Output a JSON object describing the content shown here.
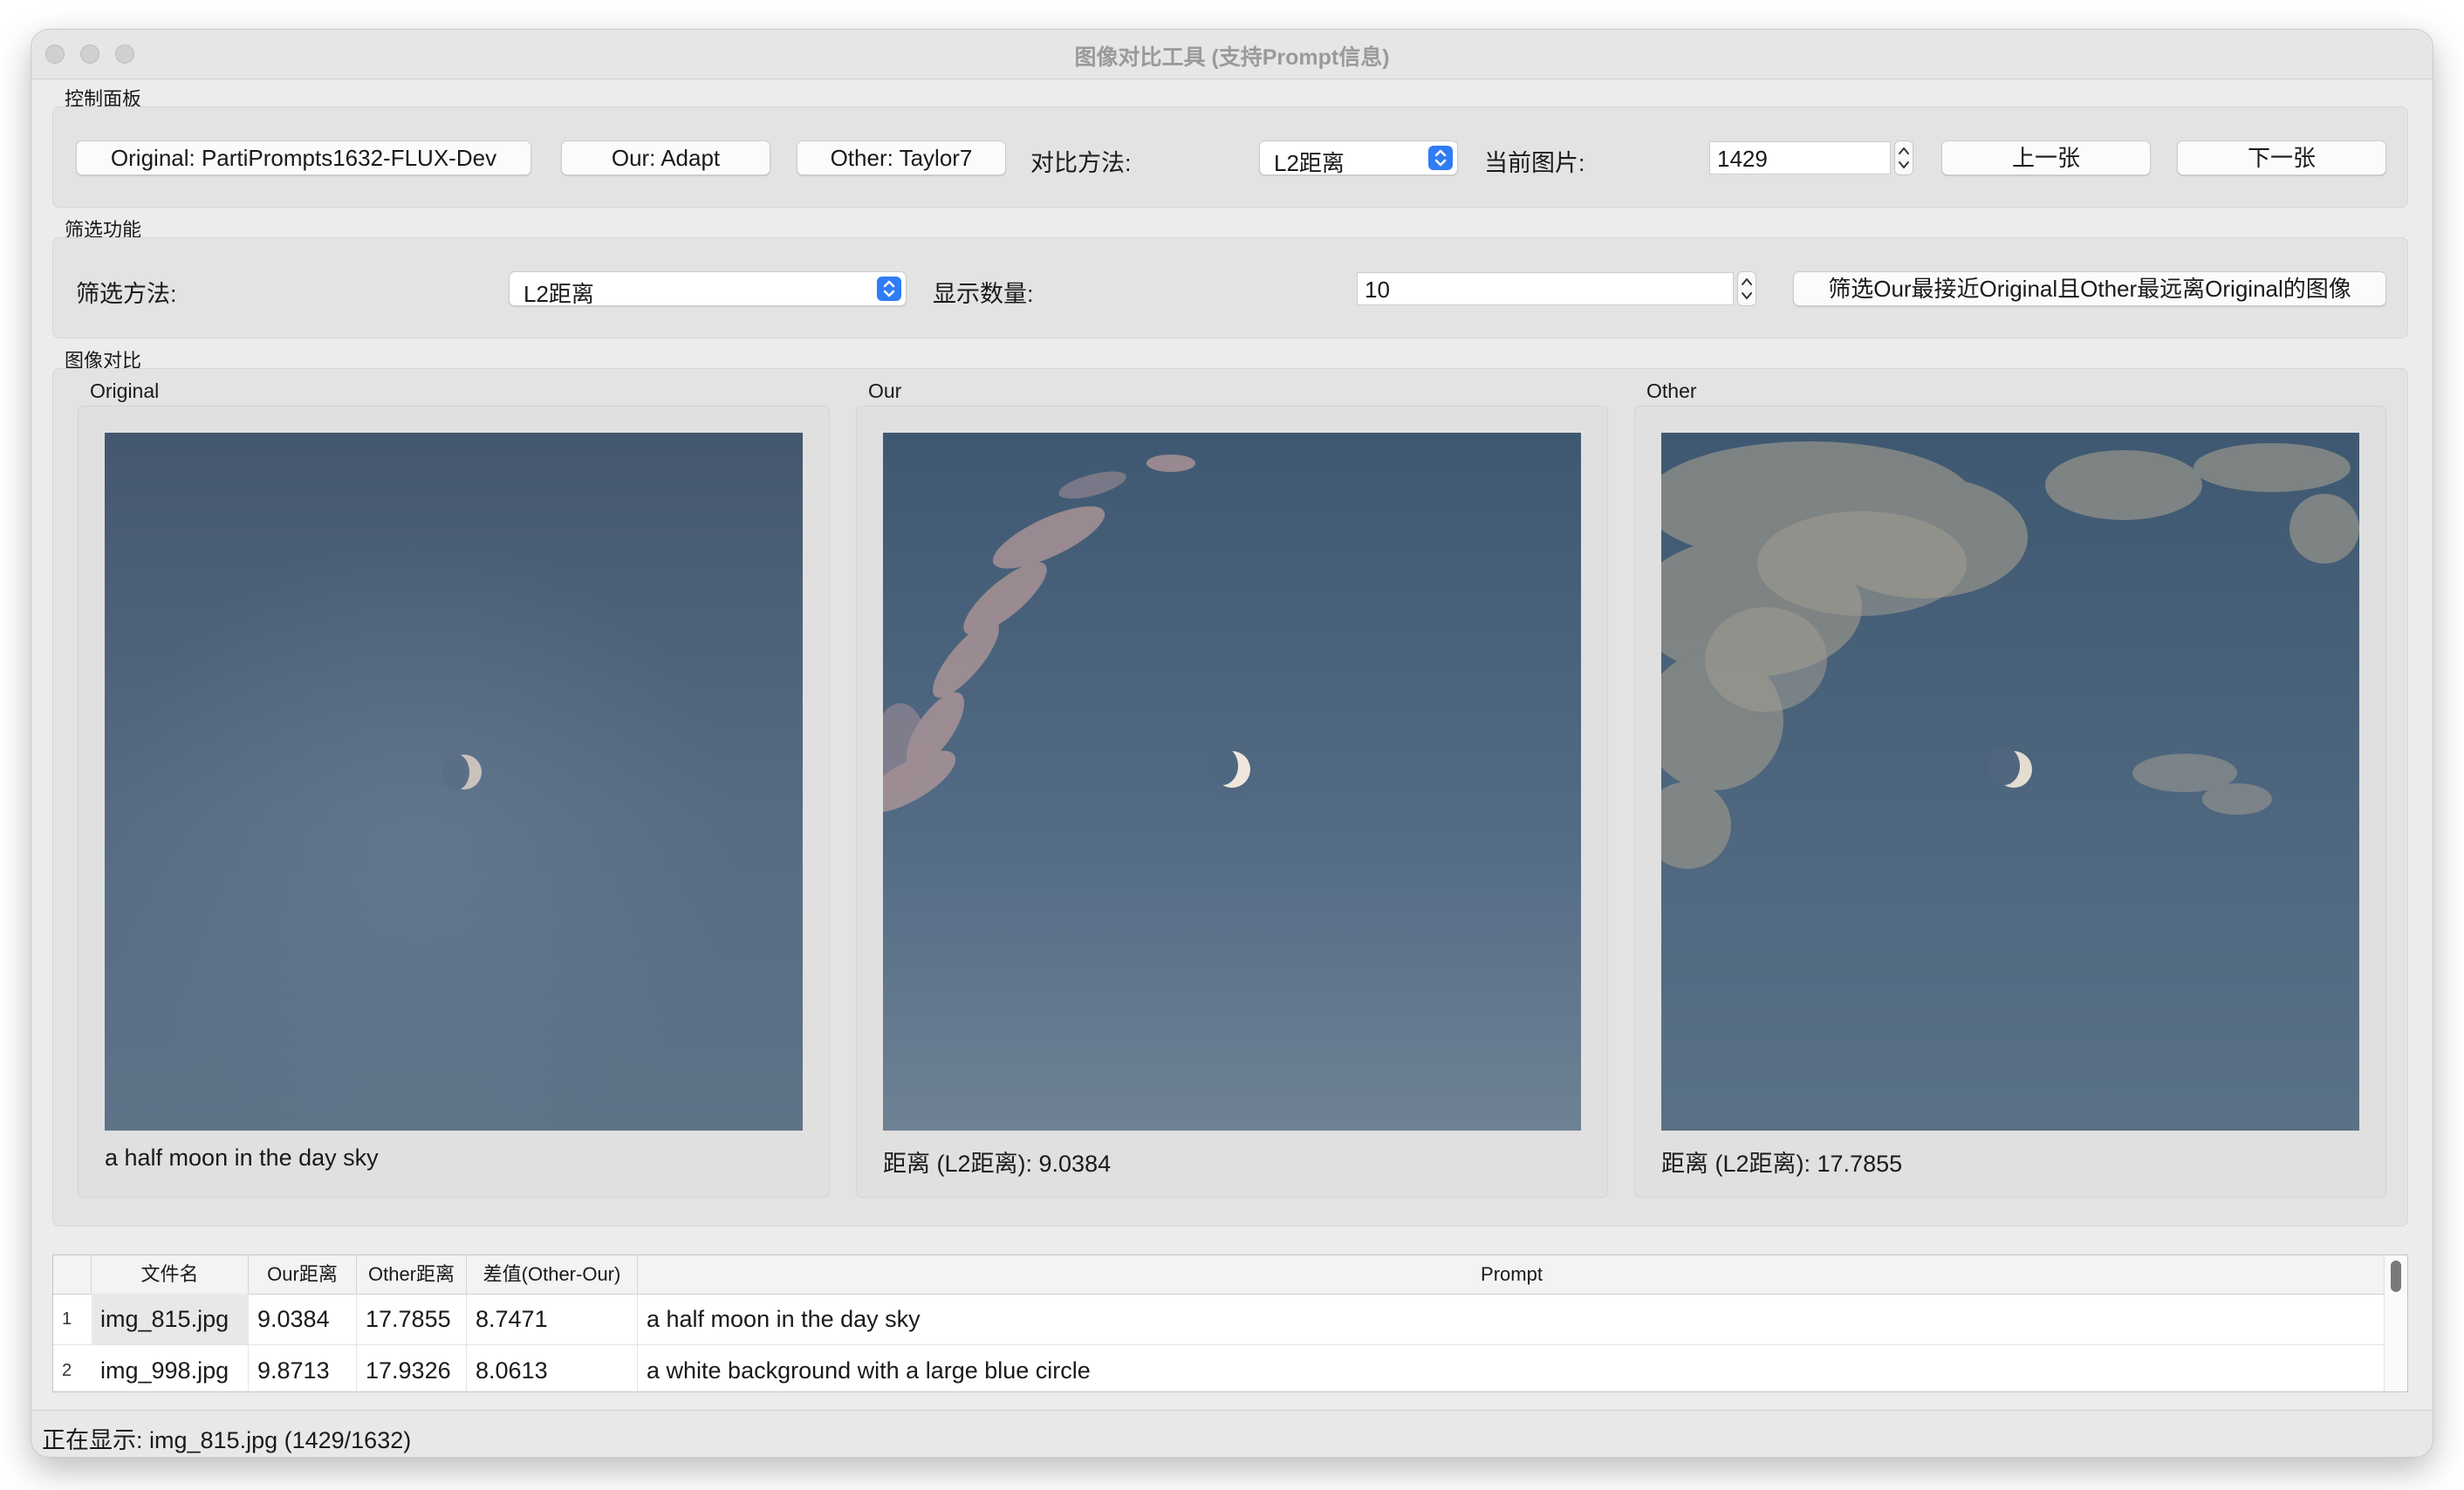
{
  "window": {
    "title": "图像对比工具 (支持Prompt信息)"
  },
  "control_panel": {
    "label": "控制面板",
    "original_button": "Original: PartiPrompts1632-FLUX-Dev",
    "our_button": "Our: Adapt",
    "other_button": "Other: Taylor7",
    "method_label": "对比方法:",
    "method_value": "L2距离",
    "current_label": "当前图片:",
    "current_value": "1429",
    "prev_button": "上一张",
    "next_button": "下一张"
  },
  "filter_panel": {
    "label": "筛选功能",
    "method_label": "筛选方法:",
    "method_value": "L2距离",
    "count_label": "显示数量:",
    "count_value": "10",
    "filter_button": "筛选Our最接近Original且Other最远离Original的图像"
  },
  "compare_panel": {
    "label": "图像对比",
    "original": {
      "title": "Original",
      "caption": "a half moon in the day sky",
      "image": "half-moon-day-sky"
    },
    "our": {
      "title": "Our",
      "caption": "距离 (L2距离): 9.0384",
      "image": "crescent-moon-pink-clouds"
    },
    "other": {
      "title": "Other",
      "caption": "距离 (L2距离): 17.7855",
      "image": "crescent-moon-cloudy-sky"
    }
  },
  "table": {
    "headers": [
      "文件名",
      "Our距离",
      "Other距离",
      "差值(Other-Our)",
      "Prompt"
    ],
    "rows": [
      {
        "num": "1",
        "file": "img_815.jpg",
        "our": "9.0384",
        "other": "17.7855",
        "diff": "8.7471",
        "prompt": "a half moon in the day sky"
      },
      {
        "num": "2",
        "file": "img_998.jpg",
        "our": "9.8713",
        "other": "17.9326",
        "diff": "8.0613",
        "prompt": "a white background with a large blue circle"
      }
    ]
  },
  "status": {
    "text": "正在显示: img_815.jpg (1429/1632)"
  },
  "colors": {
    "accent": "#2f7cf6",
    "window_bg": "#ececec",
    "group_bg": "#e3e3e3"
  }
}
